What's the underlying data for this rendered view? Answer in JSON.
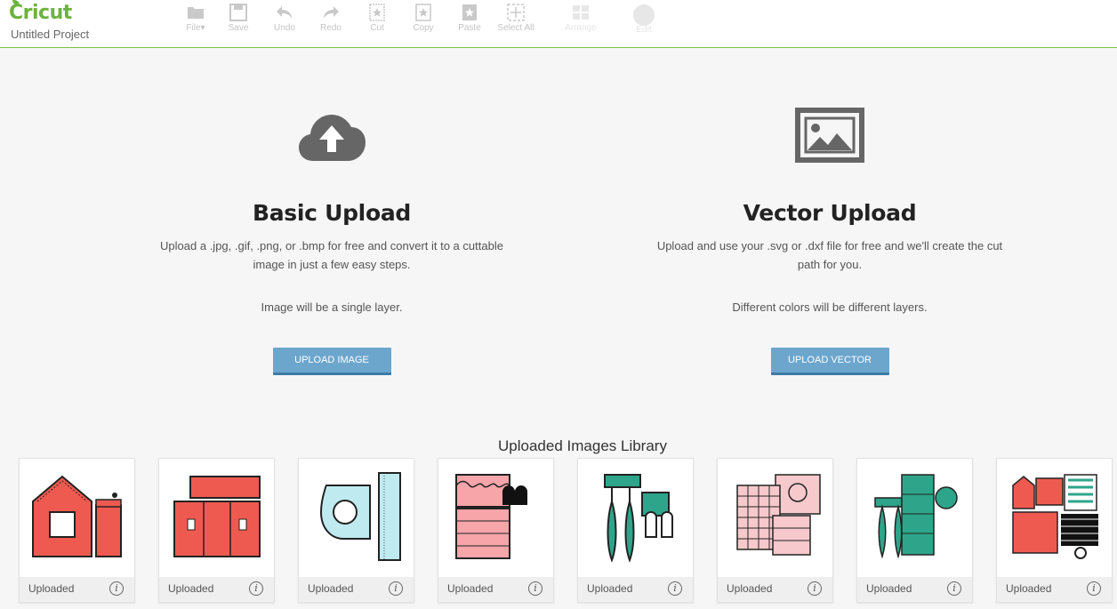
{
  "app": {
    "logo": "Cricut",
    "project_title": "Untitled Project"
  },
  "toolbar": {
    "items": [
      {
        "label": "File",
        "icon": "folder-icon"
      },
      {
        "label": "Save",
        "icon": "save-icon"
      },
      {
        "label": "Undo",
        "icon": "undo-icon"
      },
      {
        "label": "Redo",
        "icon": "redo-icon"
      },
      {
        "label": "Cut",
        "icon": "cut-icon"
      },
      {
        "label": "Copy",
        "icon": "copy-icon"
      },
      {
        "label": "Paste",
        "icon": "paste-icon"
      },
      {
        "label": "Select All",
        "icon": "select-all-icon"
      },
      {
        "label": "Arrange",
        "icon": "arrange-icon"
      },
      {
        "label": "Edit",
        "icon": "edit-icon"
      }
    ]
  },
  "basic_upload": {
    "icon": "cloud-upload-icon",
    "title": "Basic Upload",
    "description": "Upload a .jpg, .gif, .png, or .bmp for free and convert it to a cuttable image in just a few easy steps.",
    "note": "Image will be a single layer.",
    "button": "UPLOAD IMAGE"
  },
  "vector_upload": {
    "icon": "image-icon",
    "title": "Vector Upload",
    "description": "Upload and use your .svg or .dxf file for free and we'll create the cut path for you.",
    "note": "Different colors will be different layers.",
    "button": "UPLOAD VECTOR"
  },
  "library": {
    "title": "Uploaded Images Library",
    "items": [
      {
        "caption": "Uploaded",
        "info": "i",
        "color": "#ee5a50"
      },
      {
        "caption": "Uploaded",
        "info": "i",
        "color": "#ee5a50"
      },
      {
        "caption": "Uploaded",
        "info": "i",
        "color": "#bfeaf0"
      },
      {
        "caption": "Uploaded",
        "info": "i",
        "color": "#f7a5a9"
      },
      {
        "caption": "Uploaded",
        "info": "i",
        "color": "#2ea58a"
      },
      {
        "caption": "Uploaded",
        "info": "i",
        "color": "#f7c9cc"
      },
      {
        "caption": "Uploaded",
        "info": "i",
        "color": "#2ea58a"
      },
      {
        "caption": "Uploaded",
        "info": "i",
        "color": "#ee5a50"
      }
    ]
  },
  "colors": {
    "accent": "#6cb33f",
    "button": "#6ca6cd"
  }
}
